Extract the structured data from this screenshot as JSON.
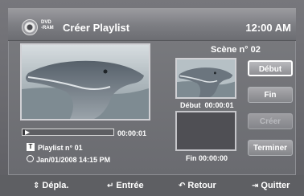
{
  "header": {
    "disc_label_top": "DVD",
    "disc_label_bottom": "-RAM",
    "title": "Créer Playlist",
    "clock": "12:00 AM"
  },
  "preview": {
    "scene_label": "Scène n° 02",
    "start_caption": "Début  00:00:01",
    "end_caption": "Fin 00:00:00"
  },
  "buttons": {
    "start": "Début",
    "end": "Fin",
    "create": "Créer",
    "finish": "Terminer"
  },
  "playback": {
    "time": "00:00:01",
    "progress": 0.03,
    "playlist_badge": "T",
    "playlist": "Playlist n° 01",
    "date": "Jan/01/2008  14:15 PM"
  },
  "footer": {
    "move": "Dépla.",
    "enter": "Entrée",
    "back": "Retour",
    "quit": "Quitter"
  }
}
